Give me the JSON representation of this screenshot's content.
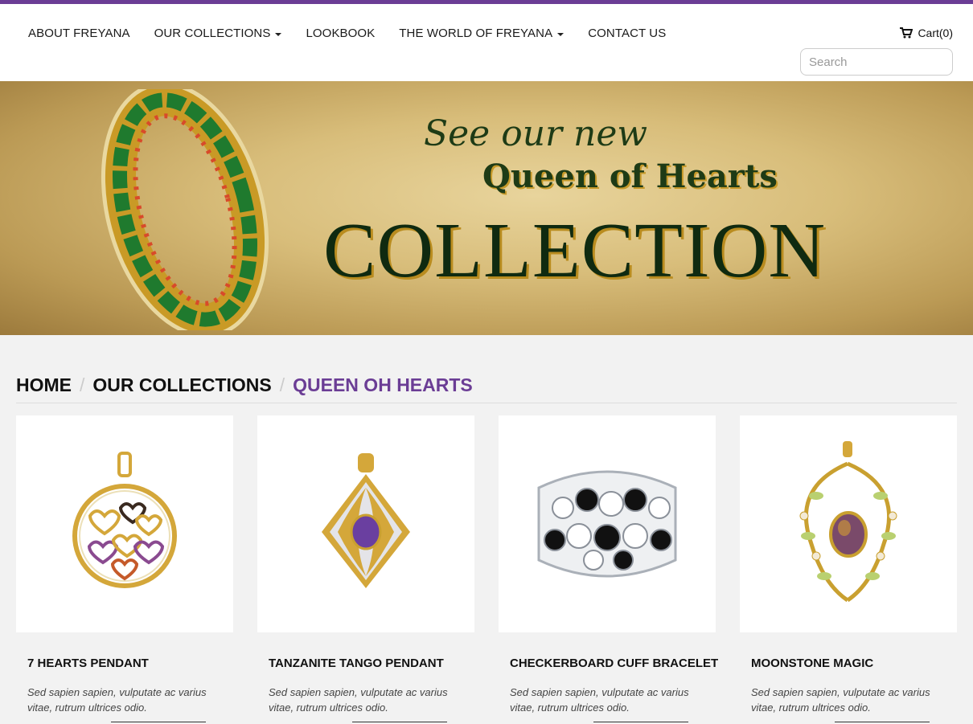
{
  "nav": {
    "items": [
      {
        "label": "ABOUT FREYANA",
        "dropdown": false
      },
      {
        "label": "OUR COLLECTIONS",
        "dropdown": true
      },
      {
        "label": "LOOKBOOK",
        "dropdown": false
      },
      {
        "label": "THE WORLD OF FREYANA",
        "dropdown": true
      },
      {
        "label": "CONTACT US",
        "dropdown": false
      }
    ]
  },
  "cart": {
    "label": "Cart(0)",
    "icon": "cart-icon"
  },
  "search": {
    "placeholder": "Search",
    "icon": "search-icon"
  },
  "banner": {
    "line1": "See our new",
    "line2": "Queen of Hearts",
    "line3": "COLLECTION"
  },
  "breadcrumb": {
    "home": "HOME",
    "section": "OUR COLLECTIONS",
    "current": "QUEEN OH HEARTS"
  },
  "products": [
    {
      "title": "7 HEARTS PENDANT",
      "desc": "Sed sapien sapien, vulputate ac varius vitae, rutrum ultrices odio."
    },
    {
      "title": "TANZANITE TANGO PENDANT",
      "desc": "Sed sapien sapien, vulputate ac varius vitae, rutrum ultrices odio."
    },
    {
      "title": "CHECKERBOARD CUFF BRACELET",
      "desc": "Sed sapien sapien, vulputate ac varius vitae, rutrum ultrices odio."
    },
    {
      "title": "MOONSTONE MAGIC",
      "desc": "Sed sapien sapien, vulputate ac varius vitae, rutrum ultrices odio."
    }
  ],
  "colors": {
    "accent": "#6b3d95",
    "banner_text": "#1e3b16"
  }
}
